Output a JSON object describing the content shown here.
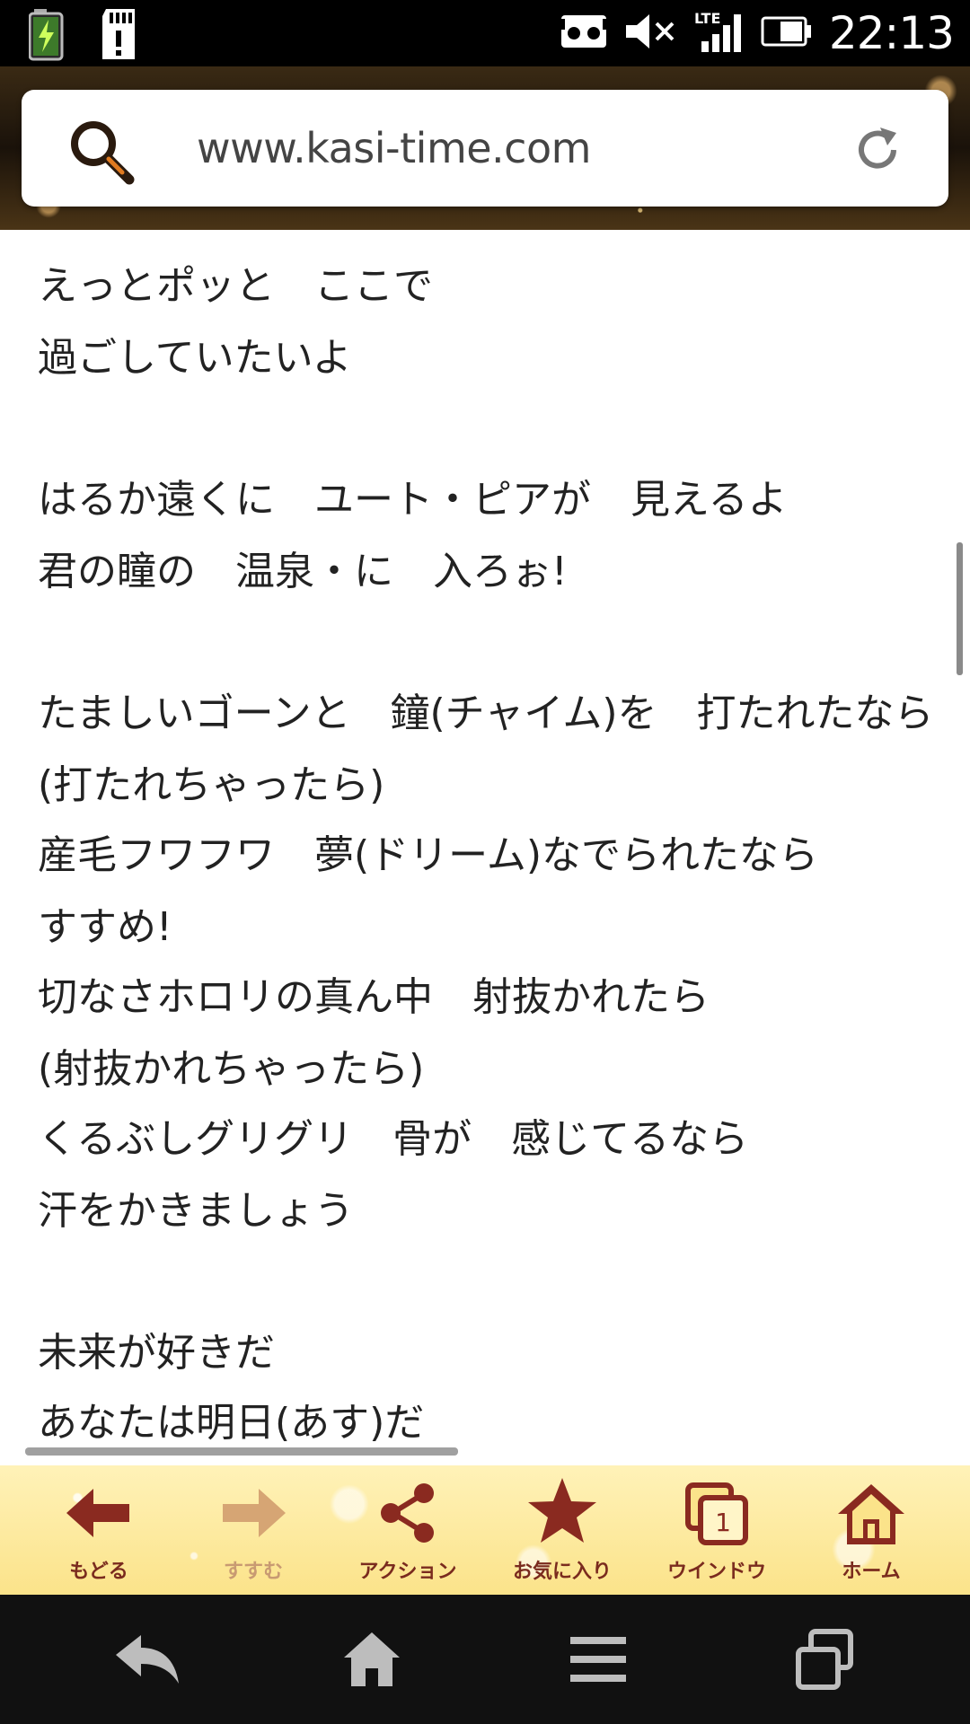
{
  "status": {
    "time": "22:13",
    "network": "LTE",
    "icons": [
      "battery-charging-icon",
      "sd-card-icon",
      "vr-icon",
      "mute-icon",
      "signal-icon",
      "battery-icon"
    ]
  },
  "browser": {
    "url": "www.kasi-time.com",
    "icons": {
      "search": "search-icon",
      "reload": "reload-icon"
    }
  },
  "lyrics": [
    "えっとポッと　ここで",
    "過ごしていたいよ",
    "",
    "はるか遠くに　ユート・ピアが　見えるよ",
    "君の瞳の　温泉・に　入ろぉ!",
    "",
    "たましいゴーンと　鐘(チャイム)を　打たれたなら",
    "(打たれちゃったら)",
    "産毛フワフワ　夢(ドリーム)なでられたなら",
    "すすめ!",
    "切なさホロリの真ん中　射抜かれたら",
    "(射抜かれちゃったら)",
    "くるぶしグリグリ　骨が　感じてるなら",
    "汗をかきましょう",
    "",
    "未来が好きだ",
    "あなたは明日(あす)だ"
  ],
  "toolbar": {
    "back": "もどる",
    "forward": "すすむ",
    "action": "アクション",
    "favorites": "お気に入り",
    "window": "ウインドウ",
    "window_count": "1",
    "home": "ホーム"
  },
  "colors": {
    "toolbar_icon": "#8a2a20",
    "toolbar_icon_disabled": "#d6a574",
    "toolbar_bg": "#fbe38a"
  }
}
